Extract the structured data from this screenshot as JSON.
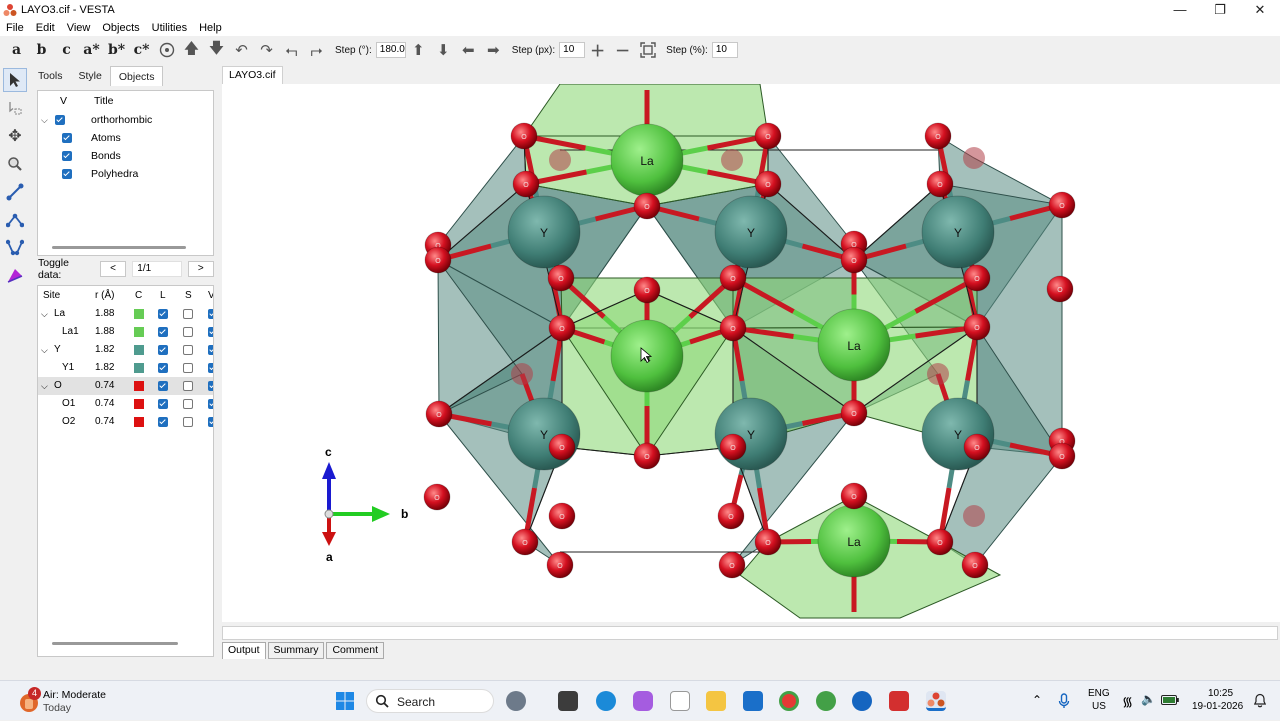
{
  "window": {
    "title": "LAYO3.cif - VESTA",
    "minimize_glyph": "—",
    "restore_glyph": "❐",
    "close_glyph": "✕"
  },
  "menu": [
    "File",
    "Edit",
    "View",
    "Objects",
    "Utilities",
    "Help"
  ],
  "toolbar": {
    "axis_buttons": [
      "a",
      "b",
      "c",
      "a*",
      "b*",
      "c*"
    ],
    "step_deg_label": "Step (°):",
    "step_deg_value": "180.0",
    "step_px_label": "Step (px):",
    "step_px_value": "10",
    "step_pct_label": "Step (%):",
    "step_pct_value": "10"
  },
  "side_panel": {
    "tabs": [
      "Tools",
      "Style",
      "Objects"
    ],
    "active_tab": "Objects",
    "tree_headers": {
      "v": "V",
      "title": "Title"
    },
    "tree": [
      {
        "label": "orthorhombic",
        "checked": true,
        "level": 0
      },
      {
        "label": "Atoms",
        "checked": true,
        "level": 1
      },
      {
        "label": "Bonds",
        "checked": true,
        "level": 1
      },
      {
        "label": "Polyhedra",
        "checked": true,
        "level": 1
      }
    ],
    "toggle_label": "Toggle data:",
    "prev": "<",
    "next": ">",
    "page": "1/1",
    "site_headers": {
      "site": "Site",
      "r": "r (Å)",
      "c": "C",
      "l": "L",
      "s": "S",
      "v": "V"
    },
    "sites": [
      {
        "site": "La",
        "r": "1.88",
        "color": "#66cc55",
        "l": true,
        "s": false,
        "group": true
      },
      {
        "site": "La1",
        "r": "1.88",
        "color": "#66cc55",
        "l": true,
        "s": false,
        "group": false
      },
      {
        "site": "Y",
        "r": "1.82",
        "color": "#4f9b8f",
        "l": true,
        "s": false,
        "group": true
      },
      {
        "site": "Y1",
        "r": "1.82",
        "color": "#4f9b8f",
        "l": true,
        "s": false,
        "group": false
      },
      {
        "site": "O",
        "r": "0.74",
        "color": "#dd1111",
        "l": true,
        "s": false,
        "group": true,
        "selected": true
      },
      {
        "site": "O1",
        "r": "0.74",
        "color": "#dd1111",
        "l": true,
        "s": false,
        "group": false
      },
      {
        "site": "O2",
        "r": "0.74",
        "color": "#dd1111",
        "l": true,
        "s": false,
        "group": false
      }
    ]
  },
  "document_tab": "LAYO3.cif",
  "structure": {
    "la_label": "La",
    "la_cursor_label": "a",
    "y_label": "Y",
    "o_label": "O",
    "axes": {
      "c": "c",
      "b": "b",
      "a": "a"
    },
    "colors": {
      "la": "#5fcf4f",
      "y": "#4a8a80",
      "o": "#d41020",
      "la_poly": "#8fd87a",
      "y_poly": "#5a8c84"
    }
  },
  "output_tabs": [
    "Output",
    "Summary",
    "Comment"
  ],
  "taskbar": {
    "weather_title": "Air: Moderate",
    "weather_sub": "Today",
    "weather_badge": "4",
    "search": "Search",
    "lang": "ENG",
    "region": "US",
    "time": "10:25",
    "date": "19-01-2026"
  }
}
